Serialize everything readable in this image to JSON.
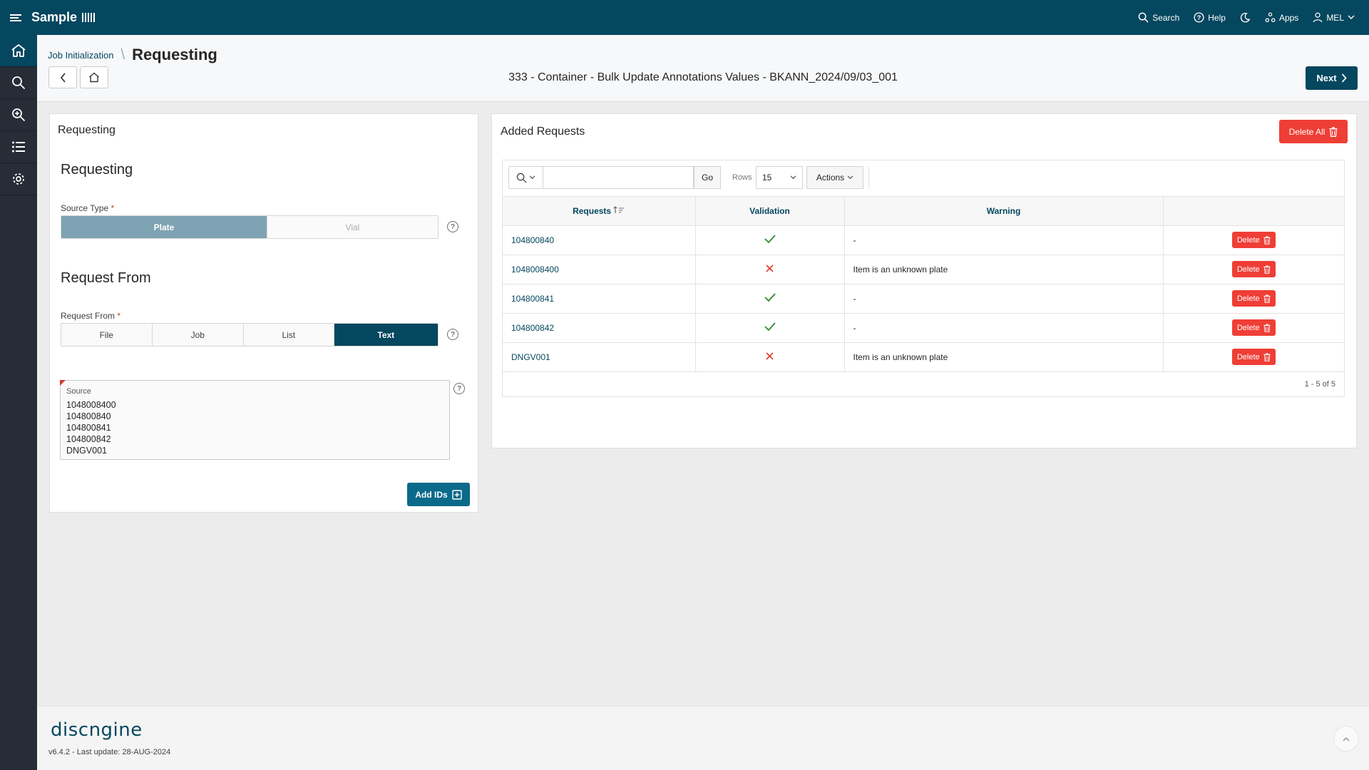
{
  "header": {
    "app_name": "Sample",
    "search_label": "Search",
    "help_label": "Help",
    "apps_label": "Apps",
    "user_label": "MEL"
  },
  "sidenav": {
    "items": [
      {
        "name": "home",
        "active": true
      },
      {
        "name": "search",
        "active": false
      },
      {
        "name": "zoom-search",
        "active": false
      },
      {
        "name": "list",
        "active": false
      },
      {
        "name": "settings",
        "active": false
      }
    ]
  },
  "titlebar": {
    "breadcrumb_parent": "Job Initialization",
    "page_title": "Requesting",
    "job_title": "333 - Container - Bulk Update Annotations Values - BKANN_2024/09/03_001",
    "next_label": "Next"
  },
  "left_panel": {
    "title": "Requesting",
    "section1_heading": "Requesting",
    "source_type_label": "Source Type",
    "required_mark": "*",
    "source_type_options": [
      "Plate",
      "Vial"
    ],
    "source_type_selected": "Plate",
    "section2_heading": "Request From",
    "request_from_label": "Request From",
    "request_from_options": [
      "File",
      "Job",
      "List",
      "Text"
    ],
    "request_from_selected": "Text",
    "source_label": "Source",
    "source_lines": [
      "1048008400",
      "104800840",
      "104800841",
      "104800842",
      "DNGV001"
    ],
    "add_ids_label": "Add IDs",
    "help_glyph": "?"
  },
  "right_panel": {
    "title": "Added Requests",
    "delete_all_label": "Delete All",
    "toolbar": {
      "go_label": "Go",
      "rows_label": "Rows",
      "rows_value": "15",
      "actions_label": "Actions"
    },
    "columns": [
      "Requests",
      "Validation",
      "Warning",
      ""
    ],
    "rows": [
      {
        "request": "104800840",
        "valid": true,
        "warning": "-",
        "delete": "Delete"
      },
      {
        "request": "1048008400",
        "valid": false,
        "warning": "Item is an unknown plate",
        "delete": "Delete"
      },
      {
        "request": "104800841",
        "valid": true,
        "warning": "-",
        "delete": "Delete"
      },
      {
        "request": "104800842",
        "valid": true,
        "warning": "-",
        "delete": "Delete"
      },
      {
        "request": "DNGV001",
        "valid": false,
        "warning": "Item is an unknown plate",
        "delete": "Delete"
      }
    ],
    "pagination": "1 - 5 of 5"
  },
  "footer": {
    "logo_text": "discngine",
    "version_text": "v6.4.2 - Last update: 28-AUG-2024"
  },
  "colors": {
    "header_bg": "#04475f",
    "sidenav_bg": "#262d36",
    "danger": "#ef3e35",
    "success": "#2e8b2e",
    "link": "#04475f"
  }
}
